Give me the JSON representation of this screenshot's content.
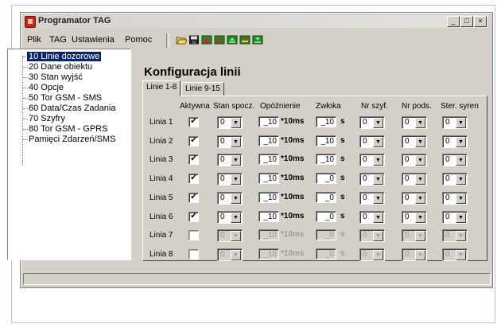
{
  "window": {
    "title": "Programator TAG"
  },
  "title_buttons": [
    "_",
    "□",
    "×"
  ],
  "menu": {
    "items": [
      {
        "label": "Plik"
      },
      {
        "label": "TAG"
      },
      {
        "label": "Ustawienia"
      },
      {
        "label": "Pomoc"
      }
    ]
  },
  "toolbar": {
    "icons": [
      "open-folder-icon",
      "save-icon",
      "upload-red-icon",
      "download-red-icon",
      "upload-green-icon",
      "compare-icon",
      "download-green-icon"
    ]
  },
  "tree": {
    "items": [
      {
        "label": "10 Linie dozorowe",
        "selected": true
      },
      {
        "label": "20 Dane obiektu"
      },
      {
        "label": "30 Stan wyjść"
      },
      {
        "label": "40 Opcje"
      },
      {
        "label": "50 Tor GSM - SMS"
      },
      {
        "label": "60 Data/Czas Zadania"
      },
      {
        "label": "70 Szyfry"
      },
      {
        "label": "80 Tor GSM - GPRS"
      },
      {
        "label": "Pamięci Zdarzeń/SMS"
      }
    ]
  },
  "content": {
    "heading": "Konfiguracja linii",
    "tabs": [
      {
        "label": "Linie 1-8",
        "active": true
      },
      {
        "label": "Linie 9-15"
      }
    ],
    "columns": {
      "active": "Aktywna",
      "rest_state": "Stan spocz.",
      "delay": "Opóźnienie",
      "delay2": "Zwłoka",
      "zone": "Nr szyf.",
      "sub": "Nr pods.",
      "siren": "Ster. syren"
    },
    "units": {
      "delay": "*10ms",
      "delay2": "s"
    },
    "rows": [
      {
        "name": "Linia 1",
        "checked": true,
        "enabled": true,
        "rest": "0",
        "delay": "_10",
        "delay2": "_10",
        "zone": "0",
        "sub": "0",
        "siren": "0"
      },
      {
        "name": "Linia 2",
        "checked": true,
        "enabled": true,
        "rest": "0",
        "delay": "_10",
        "delay2": "_10",
        "zone": "0",
        "sub": "0",
        "siren": "0"
      },
      {
        "name": "Linia 3",
        "checked": true,
        "enabled": true,
        "rest": "0",
        "delay": "_10",
        "delay2": "_10",
        "zone": "0",
        "sub": "0",
        "siren": "0"
      },
      {
        "name": "Linia 4",
        "checked": true,
        "enabled": true,
        "rest": "0",
        "delay": "_10",
        "delay2": "_0",
        "zone": "0",
        "sub": "0",
        "siren": "0"
      },
      {
        "name": "Linia 5",
        "checked": true,
        "enabled": true,
        "rest": "0",
        "delay": "_10",
        "delay2": "_0",
        "zone": "0",
        "sub": "0",
        "siren": "0"
      },
      {
        "name": "Linia 6",
        "checked": true,
        "enabled": true,
        "rest": "0",
        "delay": "_10",
        "delay2": "_0",
        "zone": "0",
        "sub": "0",
        "siren": "0"
      },
      {
        "name": "Linia 7",
        "checked": false,
        "enabled": false,
        "rest": "0",
        "delay": "_10",
        "delay2": "_0",
        "zone": "0",
        "sub": "0",
        "siren": "0"
      },
      {
        "name": "Linia 8",
        "checked": false,
        "enabled": false,
        "rest": "0",
        "delay": "_10",
        "delay2": "_0",
        "zone": "0",
        "sub": "0",
        "siren": "0"
      }
    ]
  },
  "colors": {
    "selection": "#0a246a",
    "face": "#d4d0c8",
    "disabled_text": "#9a9a9a"
  }
}
